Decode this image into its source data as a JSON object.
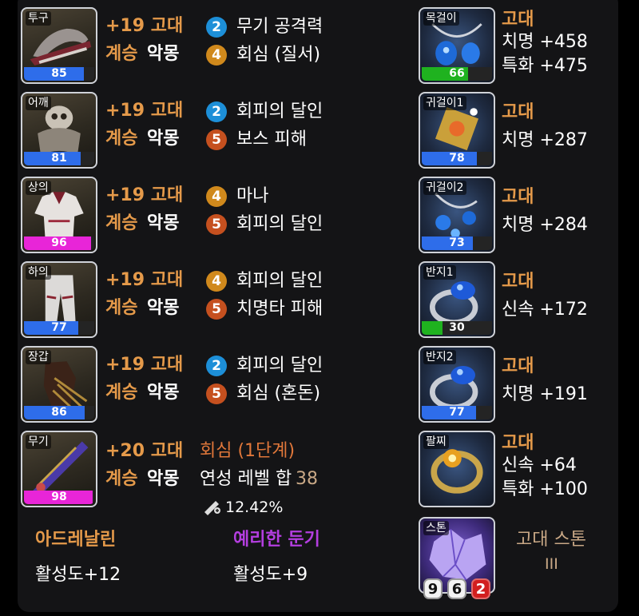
{
  "armor": [
    {
      "slot": "투구",
      "quality": "85",
      "quality_color": "#2e6dea",
      "quality_fill": 0.85,
      "level": "+19 고대",
      "succession": "계승",
      "set": "악몽",
      "engravings": [
        {
          "level": "2",
          "name": "무기 공격력",
          "color": "#1d8fd8"
        },
        {
          "level": "4",
          "name": "회심 (질서)",
          "color": "#d0891c"
        }
      ]
    },
    {
      "slot": "어깨",
      "quality": "81",
      "quality_color": "#2e6dea",
      "quality_fill": 0.81,
      "level": "+19 고대",
      "succession": "계승",
      "set": "악몽",
      "engravings": [
        {
          "level": "2",
          "name": "회피의 달인",
          "color": "#1d8fd8"
        },
        {
          "level": "5",
          "name": "보스 피해",
          "color": "#c5501f"
        }
      ]
    },
    {
      "slot": "상의",
      "quality": "96",
      "quality_color": "#e825d8",
      "quality_fill": 0.96,
      "level": "+19 고대",
      "succession": "계승",
      "set": "악몽",
      "engravings": [
        {
          "level": "4",
          "name": "마나",
          "color": "#d0891c"
        },
        {
          "level": "5",
          "name": "회피의 달인",
          "color": "#c5501f"
        }
      ]
    },
    {
      "slot": "하의",
      "quality": "77",
      "quality_color": "#2e6dea",
      "quality_fill": 0.77,
      "level": "+19 고대",
      "succession": "계승",
      "set": "악몽",
      "engravings": [
        {
          "level": "4",
          "name": "회피의 달인",
          "color": "#d0891c"
        },
        {
          "level": "5",
          "name": "치명타 피해",
          "color": "#c5501f"
        }
      ]
    },
    {
      "slot": "장갑",
      "quality": "86",
      "quality_color": "#2e6dea",
      "quality_fill": 0.86,
      "level": "+19 고대",
      "succession": "계승",
      "set": "악몽",
      "engravings": [
        {
          "level": "2",
          "name": "회피의 달인",
          "color": "#1d8fd8"
        },
        {
          "level": "5",
          "name": "회심 (혼돈)",
          "color": "#c5501f"
        }
      ]
    }
  ],
  "weapon": {
    "slot": "무기",
    "quality": "98",
    "quality_color": "#e825d8",
    "quality_fill": 0.98,
    "level": "+20 고대",
    "succession": "계승",
    "set": "악몽",
    "elixir": "회심 (1단계)",
    "elixir_sum_label": "연성 레벨 합",
    "elixir_sum": "38",
    "transcend_percent": "12.42%"
  },
  "accessories": [
    {
      "slot": "목걸이",
      "quality": "66",
      "quality_color": "#1fb21f",
      "quality_fill": 0.66,
      "grade": "고대",
      "stats": [
        "치명 +458",
        "특화 +475"
      ]
    },
    {
      "slot": "귀걸이1",
      "quality": "78",
      "quality_color": "#2e6dea",
      "quality_fill": 0.78,
      "grade": "고대",
      "stats": [
        "치명 +287"
      ]
    },
    {
      "slot": "귀걸이2",
      "quality": "73",
      "quality_color": "#2e6dea",
      "quality_fill": 0.73,
      "grade": "고대",
      "stats": [
        "치명 +284"
      ]
    },
    {
      "slot": "반지1",
      "quality": "30",
      "quality_color": "#1fb21f",
      "quality_fill": 0.3,
      "grade": "고대",
      "stats": [
        "신속 +172"
      ]
    },
    {
      "slot": "반지2",
      "quality": "77",
      "quality_color": "#2e6dea",
      "quality_fill": 0.77,
      "grade": "고대",
      "stats": [
        "치명 +191"
      ]
    },
    {
      "slot": "팔찌",
      "grade": "고대",
      "stats": [
        "신속 +64",
        "특화 +100"
      ]
    }
  ],
  "stone": {
    "slot": "스톤",
    "grade": "고대 스톤",
    "tier": "III",
    "nums": [
      "9",
      "6",
      "2"
    ]
  },
  "bottom": [
    {
      "name": "아드레날린",
      "value": "활성도+12",
      "color": "#e59a4a"
    },
    {
      "name": "예리한 둔기",
      "value": "활성도+9",
      "color": "#b43ee0"
    }
  ]
}
